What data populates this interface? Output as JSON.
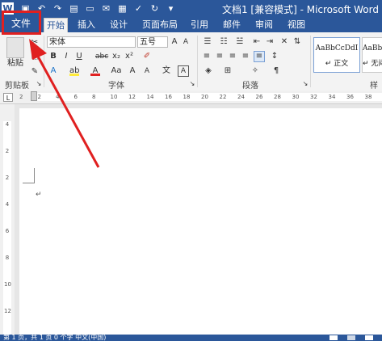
{
  "window": {
    "title": "文档1 [兼容模式] - Microsoft Word"
  },
  "quick_access": {
    "icons": [
      "word-logo-icon",
      "save-icon",
      "undo-icon",
      "redo-icon",
      "new-doc-icon",
      "open-icon",
      "email-icon",
      "print-preview-icon",
      "spelling-icon",
      "repeat-icon",
      "dropdown-icon"
    ]
  },
  "tabs": {
    "file": "文件",
    "items": [
      "开始",
      "插入",
      "设计",
      "页面布局",
      "引用",
      "邮件",
      "审阅",
      "视图"
    ]
  },
  "clipboard": {
    "paste_label": "粘贴",
    "group_label": "剪贴板"
  },
  "font": {
    "name": "宋体",
    "size": "五号",
    "group_label": "字体",
    "buttons": [
      "B",
      "I",
      "U",
      "abc",
      "x₂",
      "x²",
      "A",
      "Aa",
      "A",
      "A"
    ]
  },
  "paragraph": {
    "group_label": "段落"
  },
  "styles": {
    "items": [
      {
        "preview": "AaBbCcDdI",
        "name": "↵ 正文"
      },
      {
        "preview": "AaBbC",
        "name": "↵ 无间"
      }
    ],
    "group_label": "样式"
  },
  "ruler": {
    "ticks": [
      "2",
      "2",
      "4",
      "6",
      "8",
      "10",
      "12",
      "14",
      "16",
      "18",
      "20",
      "22",
      "24",
      "26",
      "28",
      "30",
      "32",
      "34",
      "36",
      "38"
    ]
  },
  "vruler": {
    "ticks": [
      "4",
      "2",
      "2",
      "4",
      "6",
      "8",
      "10",
      "12"
    ]
  },
  "document": {
    "para_mark": "↵"
  },
  "status": {
    "text": "第 1 页，共 1 页    0 个字    中文(中国)"
  },
  "colors": {
    "accent": "#2b579a",
    "highlight": "#e02020"
  }
}
